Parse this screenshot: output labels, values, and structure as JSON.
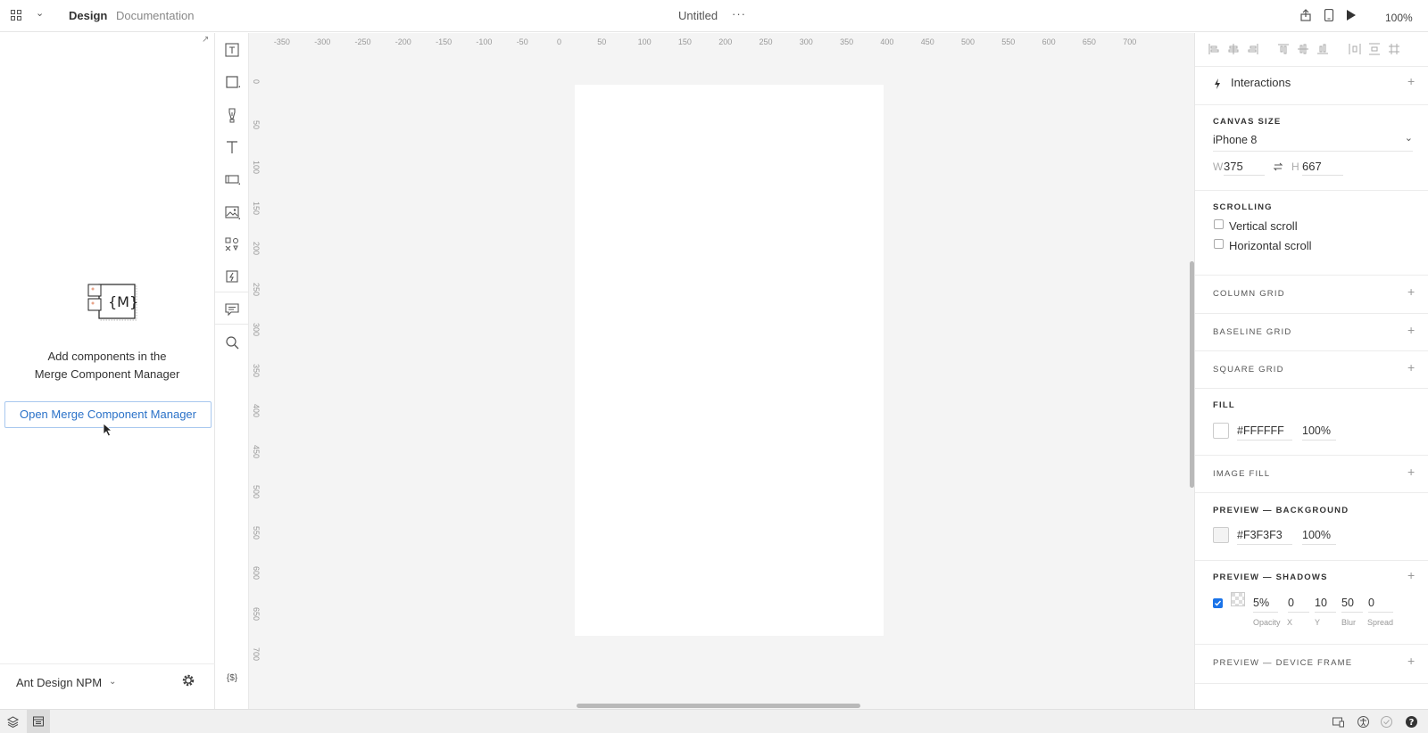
{
  "topbar": {
    "tab_design": "Design",
    "tab_documentation": "Documentation",
    "title": "Untitled",
    "more": "···",
    "zoom": "100%"
  },
  "left_panel": {
    "empty_text_line1": "Add components in the",
    "empty_text_line2": "Merge Component Manager",
    "open_button": "Open Merge Component Manager",
    "illustration_text": "{M}",
    "library_name": "Ant Design NPM",
    "footer_code_icon": "{$}"
  },
  "canvas": {
    "h_ruler": [
      "-350",
      "-300",
      "-250",
      "-200",
      "-150",
      "-100",
      "-50",
      "0",
      "50",
      "100",
      "150",
      "200",
      "250",
      "300",
      "350",
      "400",
      "450",
      "500",
      "550",
      "600",
      "650",
      "700"
    ],
    "v_ruler": [
      "0",
      "50",
      "100",
      "150",
      "200",
      "250",
      "300",
      "350",
      "400",
      "450",
      "500",
      "550",
      "600",
      "650",
      "700"
    ]
  },
  "right_panel": {
    "interactions_label": "Interactions",
    "canvas_size": {
      "label": "CANVAS SIZE",
      "preset": "iPhone 8",
      "w_label": "W",
      "w_value": "375",
      "h_label": "H",
      "h_value": "667"
    },
    "scrolling": {
      "label": "SCROLLING",
      "vertical": "Vertical scroll",
      "horizontal": "Horizontal scroll"
    },
    "column_grid": "COLUMN GRID",
    "baseline_grid": "BASELINE GRID",
    "square_grid": "SQUARE GRID",
    "fill": {
      "label": "FILL",
      "hex": "#FFFFFF",
      "opacity": "100%"
    },
    "image_fill": "IMAGE FILL",
    "preview_background": {
      "label": "PREVIEW — BACKGROUND",
      "hex": "#F3F3F3",
      "opacity": "100%"
    },
    "preview_shadows": {
      "label": "PREVIEW — SHADOWS",
      "opacity": "5%",
      "x": "0",
      "y": "10",
      "blur": "50",
      "spread": "0",
      "cap_opacity": "Opacity",
      "cap_x": "X",
      "cap_y": "Y",
      "cap_blur": "Blur",
      "cap_spread": "Spread"
    },
    "preview_device_frame": "PREVIEW — DEVICE FRAME"
  },
  "colors": {
    "accent": "#2b72c8",
    "canvas_bg": "#f4f4f4",
    "checkbox_checked": "#1a73e8"
  }
}
